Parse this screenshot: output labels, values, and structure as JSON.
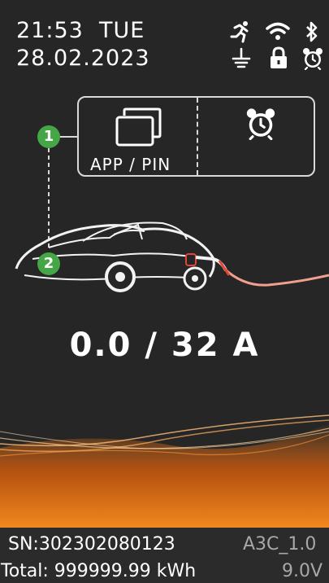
{
  "status_bar": {
    "time": "21:53",
    "day": "TUE",
    "date": "28.02.2023",
    "icons": [
      "runner-icon",
      "wifi-icon",
      "bluetooth-icon",
      "ground-icon",
      "lock-icon",
      "alarm-clock-icon"
    ]
  },
  "auth_panel": {
    "mode_label": "APP / PIN",
    "icons": [
      "app-windows-icon",
      "alarm-clock-icon"
    ]
  },
  "callouts": {
    "badge_1": "1",
    "badge_2": "2"
  },
  "charging": {
    "current_reading": "0.0 / 32 A"
  },
  "footer": {
    "serial": "SN:302302080123",
    "firmware": "A3C_1.0",
    "total_energy": "Total: 999999.99 kWh",
    "voltage": "9.0V"
  },
  "colors": {
    "background": "#262626",
    "badge_green": "#45a646",
    "glow_orange": "#f07c1c",
    "cable_red": "#e2453a",
    "text": "#ffffff"
  }
}
